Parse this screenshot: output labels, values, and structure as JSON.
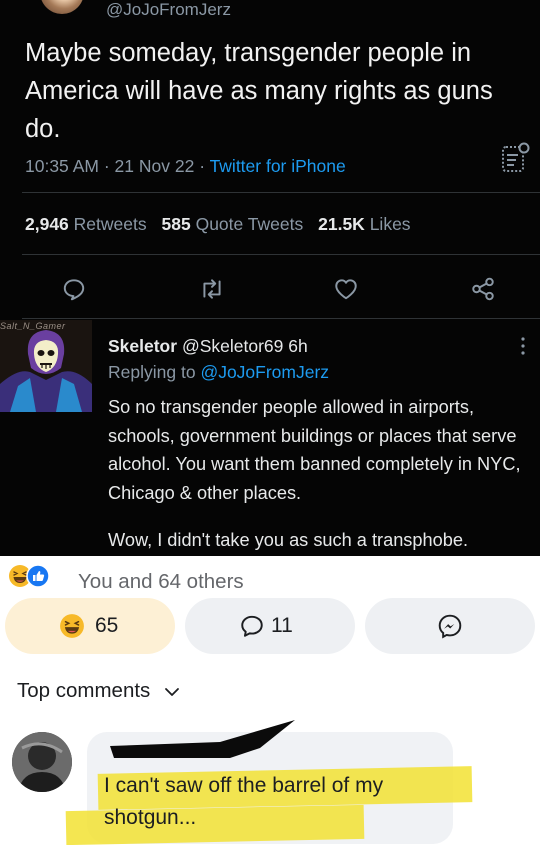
{
  "tweet": {
    "handle": "@JoJoFromJerz",
    "text": "Maybe someday, transgender people in America will have as many rights as guns do.",
    "time": "10:35 AM",
    "dot": "·",
    "date": "21 Nov 22",
    "source": "Twitter for iPhone",
    "retweets_count": "2,946",
    "retweets_label": "Retweets",
    "quotes_count": "585",
    "quotes_label": "Quote Tweets",
    "likes_count": "21.5K",
    "likes_label": "Likes",
    "icons": [
      "reply-icon",
      "retweet-icon",
      "like-icon",
      "share-icon",
      "analytics-icon"
    ]
  },
  "reply": {
    "watermark": "Salt_N_Gamer",
    "name": "Skeletor",
    "handle": "@Skeletor69",
    "age": "6h",
    "replying_prefix": "Replying to",
    "replying_to": "@JoJoFromJerz",
    "body": "So no transgender people allowed in airports, schools, government buildings or places that serve alcohol. You want them banned completely in NYC, Chicago & other places.",
    "last_line": "Wow, I didn't take you as such a transphobe."
  },
  "facebook": {
    "reactions_summary": "You and 64 others",
    "haha_count": "65",
    "comment_count": "11",
    "top_comments_label": "Top comments",
    "comment_text": "I can't saw off the barrel of my shotgun...",
    "colors": {
      "haha_pill": "#fdf0d5",
      "neutral_pill": "#eef0f3",
      "highlight": "#f2e232",
      "blue": "#1d9bf0"
    }
  }
}
